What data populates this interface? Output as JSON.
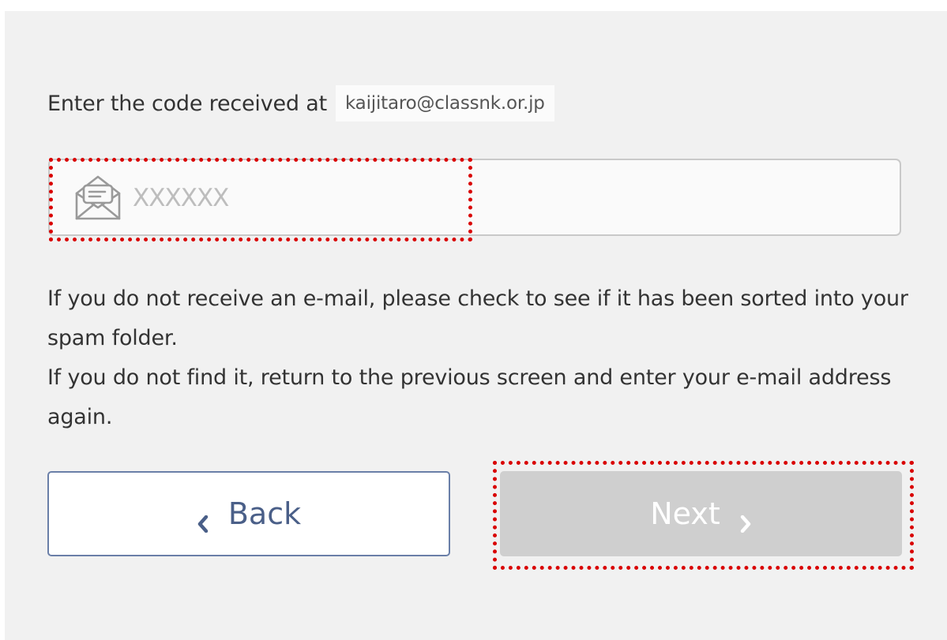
{
  "prompt": {
    "text": "Enter the code received at",
    "email": "kaijitaro@classnk.or.jp"
  },
  "code_field": {
    "placeholder": "XXXXXX",
    "value": "",
    "icon": "envelope-icon"
  },
  "help": {
    "line1": "If you do not receive an e-mail, please check to see if it has been sorted into your spam folder.",
    "line2": "If you do not find it, return to the previous screen and enter your e-mail address again."
  },
  "buttons": {
    "back_label": "Back",
    "next_label": "Next",
    "back_icon": "chevron-left-icon",
    "next_icon": "chevron-right-icon"
  },
  "colors": {
    "highlight": "#d90000",
    "back_border": "#6a7fa8",
    "next_disabled_bg": "#cfcfcf"
  }
}
